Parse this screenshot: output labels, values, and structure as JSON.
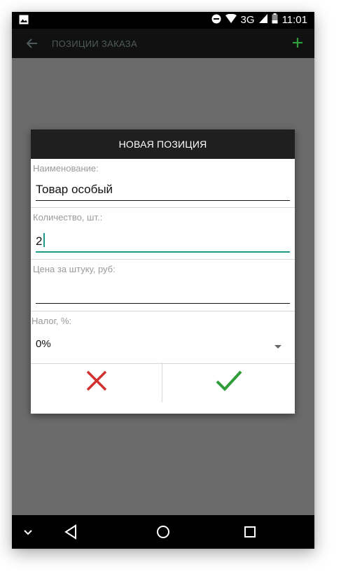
{
  "status_bar": {
    "network": "3G",
    "time": "11:01",
    "icons": [
      "image-icon",
      "do-not-disturb-icon",
      "wifi-icon",
      "signal-icon",
      "battery-icon"
    ]
  },
  "app_bar": {
    "title": "ПОЗИЦИИ ЗАКАЗА",
    "back_icon": "back-arrow-icon",
    "add_icon": "add-icon"
  },
  "dialog": {
    "title": "НОВАЯ ПОЗИЦИЯ",
    "fields": {
      "name": {
        "label": "Наименование:",
        "value": "Товар особый"
      },
      "quantity": {
        "label": "Количество, шт.:",
        "value": "2"
      },
      "price": {
        "label": "Цена за штуку, руб:",
        "value": ""
      },
      "tax": {
        "label": "Налог, %:",
        "selected": "0%"
      }
    },
    "cancel_icon": "close-icon",
    "confirm_icon": "check-icon"
  },
  "nav_bar": {
    "buttons": [
      "chevron-down-icon",
      "back-triangle-icon",
      "home-circle-icon",
      "recents-square-icon"
    ]
  },
  "colors": {
    "accent": "#1d9a8a",
    "add_green": "#2e9d3a",
    "cancel_red": "#d32f2f",
    "confirm_green": "#2e9d3a"
  }
}
